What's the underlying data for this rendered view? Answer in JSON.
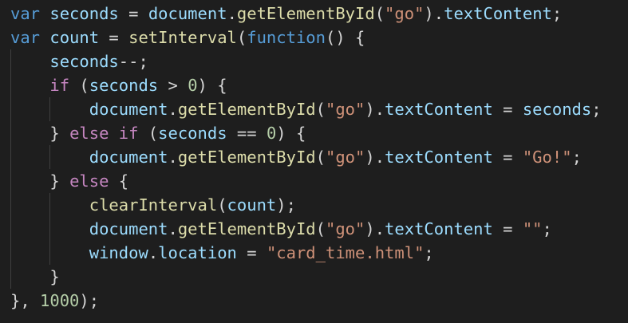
{
  "editor": {
    "language": "javascript",
    "theme": "dark",
    "lines": [
      [
        {
          "t": "var",
          "c": "kw"
        },
        {
          "t": " ",
          "c": "punc"
        },
        {
          "t": "seconds",
          "c": "var"
        },
        {
          "t": " = ",
          "c": "punc"
        },
        {
          "t": "document",
          "c": "var"
        },
        {
          "t": ".",
          "c": "punc"
        },
        {
          "t": "getElementById",
          "c": "fn"
        },
        {
          "t": "(",
          "c": "punc"
        },
        {
          "t": "\"go\"",
          "c": "str"
        },
        {
          "t": ").",
          "c": "punc"
        },
        {
          "t": "textContent",
          "c": "var"
        },
        {
          "t": ";",
          "c": "punc"
        }
      ],
      [
        {
          "t": "var",
          "c": "kw"
        },
        {
          "t": " ",
          "c": "punc"
        },
        {
          "t": "count",
          "c": "var"
        },
        {
          "t": " = ",
          "c": "punc"
        },
        {
          "t": "setInterval",
          "c": "fn"
        },
        {
          "t": "(",
          "c": "punc"
        },
        {
          "t": "function",
          "c": "kw"
        },
        {
          "t": "() {",
          "c": "punc"
        }
      ],
      [
        {
          "t": "    ",
          "c": "punc"
        },
        {
          "t": "seconds",
          "c": "var"
        },
        {
          "t": "--;",
          "c": "punc"
        }
      ],
      [
        {
          "t": "    ",
          "c": "punc"
        },
        {
          "t": "if",
          "c": "ctrl"
        },
        {
          "t": " (",
          "c": "punc"
        },
        {
          "t": "seconds",
          "c": "var"
        },
        {
          "t": " > ",
          "c": "punc"
        },
        {
          "t": "0",
          "c": "num"
        },
        {
          "t": ") {",
          "c": "punc"
        }
      ],
      [
        {
          "t": "        ",
          "c": "punc"
        },
        {
          "t": "document",
          "c": "var"
        },
        {
          "t": ".",
          "c": "punc"
        },
        {
          "t": "getElementById",
          "c": "fn"
        },
        {
          "t": "(",
          "c": "punc"
        },
        {
          "t": "\"go\"",
          "c": "str"
        },
        {
          "t": ").",
          "c": "punc"
        },
        {
          "t": "textContent",
          "c": "var"
        },
        {
          "t": " = ",
          "c": "punc"
        },
        {
          "t": "seconds",
          "c": "var"
        },
        {
          "t": ";",
          "c": "punc"
        }
      ],
      [
        {
          "t": "    } ",
          "c": "punc"
        },
        {
          "t": "else",
          "c": "ctrl"
        },
        {
          "t": " ",
          "c": "punc"
        },
        {
          "t": "if",
          "c": "ctrl"
        },
        {
          "t": " (",
          "c": "punc"
        },
        {
          "t": "seconds",
          "c": "var"
        },
        {
          "t": " == ",
          "c": "punc"
        },
        {
          "t": "0",
          "c": "num"
        },
        {
          "t": ") {",
          "c": "punc"
        }
      ],
      [
        {
          "t": "        ",
          "c": "punc"
        },
        {
          "t": "document",
          "c": "var"
        },
        {
          "t": ".",
          "c": "punc"
        },
        {
          "t": "getElementById",
          "c": "fn"
        },
        {
          "t": "(",
          "c": "punc"
        },
        {
          "t": "\"go\"",
          "c": "str"
        },
        {
          "t": ").",
          "c": "punc"
        },
        {
          "t": "textContent",
          "c": "var"
        },
        {
          "t": " = ",
          "c": "punc"
        },
        {
          "t": "\"Go!\"",
          "c": "str"
        },
        {
          "t": ";",
          "c": "punc"
        }
      ],
      [
        {
          "t": "    } ",
          "c": "punc"
        },
        {
          "t": "else",
          "c": "ctrl"
        },
        {
          "t": " {",
          "c": "punc"
        }
      ],
      [
        {
          "t": "        ",
          "c": "punc"
        },
        {
          "t": "clearInterval",
          "c": "fn"
        },
        {
          "t": "(",
          "c": "punc"
        },
        {
          "t": "count",
          "c": "var"
        },
        {
          "t": ");",
          "c": "punc"
        }
      ],
      [
        {
          "t": "        ",
          "c": "punc"
        },
        {
          "t": "document",
          "c": "var"
        },
        {
          "t": ".",
          "c": "punc"
        },
        {
          "t": "getElementById",
          "c": "fn"
        },
        {
          "t": "(",
          "c": "punc"
        },
        {
          "t": "\"go\"",
          "c": "str"
        },
        {
          "t": ").",
          "c": "punc"
        },
        {
          "t": "textContent",
          "c": "var"
        },
        {
          "t": " = ",
          "c": "punc"
        },
        {
          "t": "\"\"",
          "c": "str"
        },
        {
          "t": ";",
          "c": "punc"
        }
      ],
      [
        {
          "t": "        ",
          "c": "punc"
        },
        {
          "t": "window",
          "c": "var"
        },
        {
          "t": ".",
          "c": "punc"
        },
        {
          "t": "location",
          "c": "var"
        },
        {
          "t": " = ",
          "c": "punc"
        },
        {
          "t": "\"card_time.html\"",
          "c": "str"
        },
        {
          "t": ";",
          "c": "punc"
        }
      ],
      [
        {
          "t": "    }",
          "c": "punc"
        }
      ],
      [
        {
          "t": "}, ",
          "c": "punc"
        },
        {
          "t": "1000",
          "c": "num"
        },
        {
          "t": ");",
          "c": "punc"
        }
      ]
    ],
    "colors": {
      "background": "#1e1e1e",
      "keyword": "#569cd6",
      "control": "#c586c0",
      "variable": "#9cdcfe",
      "function": "#dcdcaa",
      "string": "#ce9178",
      "number": "#b5cea8",
      "punctuation": "#d4d4d4",
      "indent_guide": "#404040"
    }
  }
}
